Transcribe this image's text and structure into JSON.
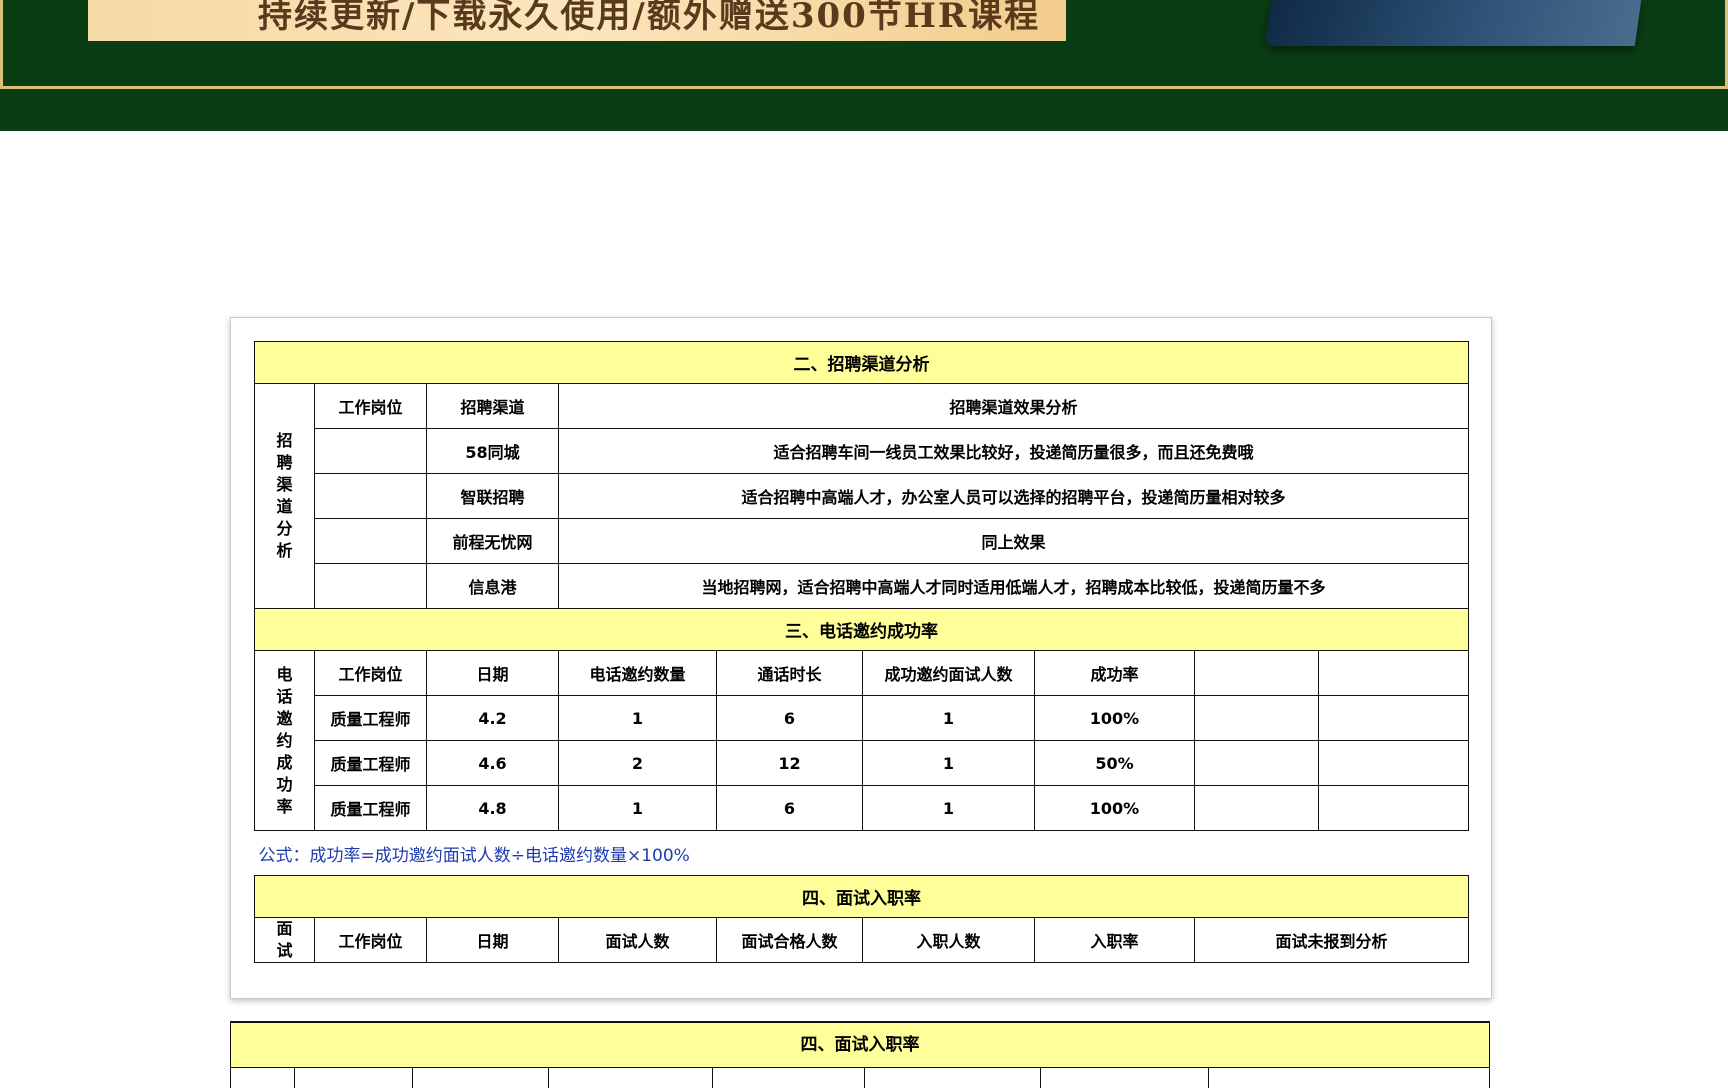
{
  "banner": {
    "text": "持续更新/下载永久使用/额外赠送300节HR课程"
  },
  "channel_section": {
    "title": "二、招聘渠道分析",
    "side_label": "招聘渠道分析",
    "headers": [
      "工作岗位",
      "招聘渠道",
      "招聘渠道效果分析"
    ],
    "rows": [
      {
        "position": "",
        "channel": "58同城",
        "analysis": "适合招聘车间一线员工效果比较好，投递简历量很多，而且还免费哦"
      },
      {
        "position": "",
        "channel": "智联招聘",
        "analysis": "适合招聘中高端人才，办公室人员可以选择的招聘平台，投递简历量相对较多"
      },
      {
        "position": "",
        "channel": "前程无忧网",
        "analysis": "同上效果"
      },
      {
        "position": "",
        "channel": "信息港",
        "analysis": "当地招聘网，适合招聘中高端人才同时适用低端人才，招聘成本比较低，投递简历量不多"
      }
    ]
  },
  "phone_section": {
    "title": "三、电话邀约成功率",
    "side_label": "电话邀约成功率",
    "headers": [
      "工作岗位",
      "日期",
      "电话邀约数量",
      "通话时长",
      "成功邀约面试人数",
      "成功率",
      "",
      ""
    ],
    "rows": [
      [
        "质量工程师",
        "4.2",
        "1",
        "6",
        "1",
        "100%",
        "",
        ""
      ],
      [
        "质量工程师",
        "4.6",
        "2",
        "12",
        "1",
        "50%",
        "",
        ""
      ],
      [
        "质量工程师",
        "4.8",
        "1",
        "6",
        "1",
        "100%",
        "",
        ""
      ]
    ],
    "formula": "公式：成功率=成功邀约面试人数÷电话邀约数量×100%"
  },
  "interview_section": {
    "title": "四、面试入职率",
    "side_label": "面试",
    "headers": [
      "工作岗位",
      "日期",
      "面试人数",
      "面试合格人数",
      "入职人数",
      "入职率",
      "面试未报到分析"
    ]
  },
  "next_page": {
    "title": "四、面试入职率"
  }
}
